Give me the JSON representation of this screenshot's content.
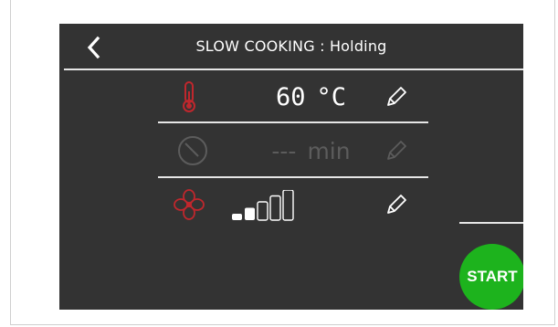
{
  "header": {
    "title": "SLOW COOKING : Holding"
  },
  "temperature": {
    "icon": "thermometer-icon",
    "value": "60",
    "unit": "°C",
    "color": "#c0272d"
  },
  "time": {
    "icon": "clock-icon",
    "value": "---",
    "unit": "min",
    "enabled": false
  },
  "fan": {
    "icon": "fan-icon",
    "level": 2,
    "max_level": 5,
    "color": "#c0272d"
  },
  "start_button": {
    "label": "START",
    "color": "#1db31d"
  }
}
